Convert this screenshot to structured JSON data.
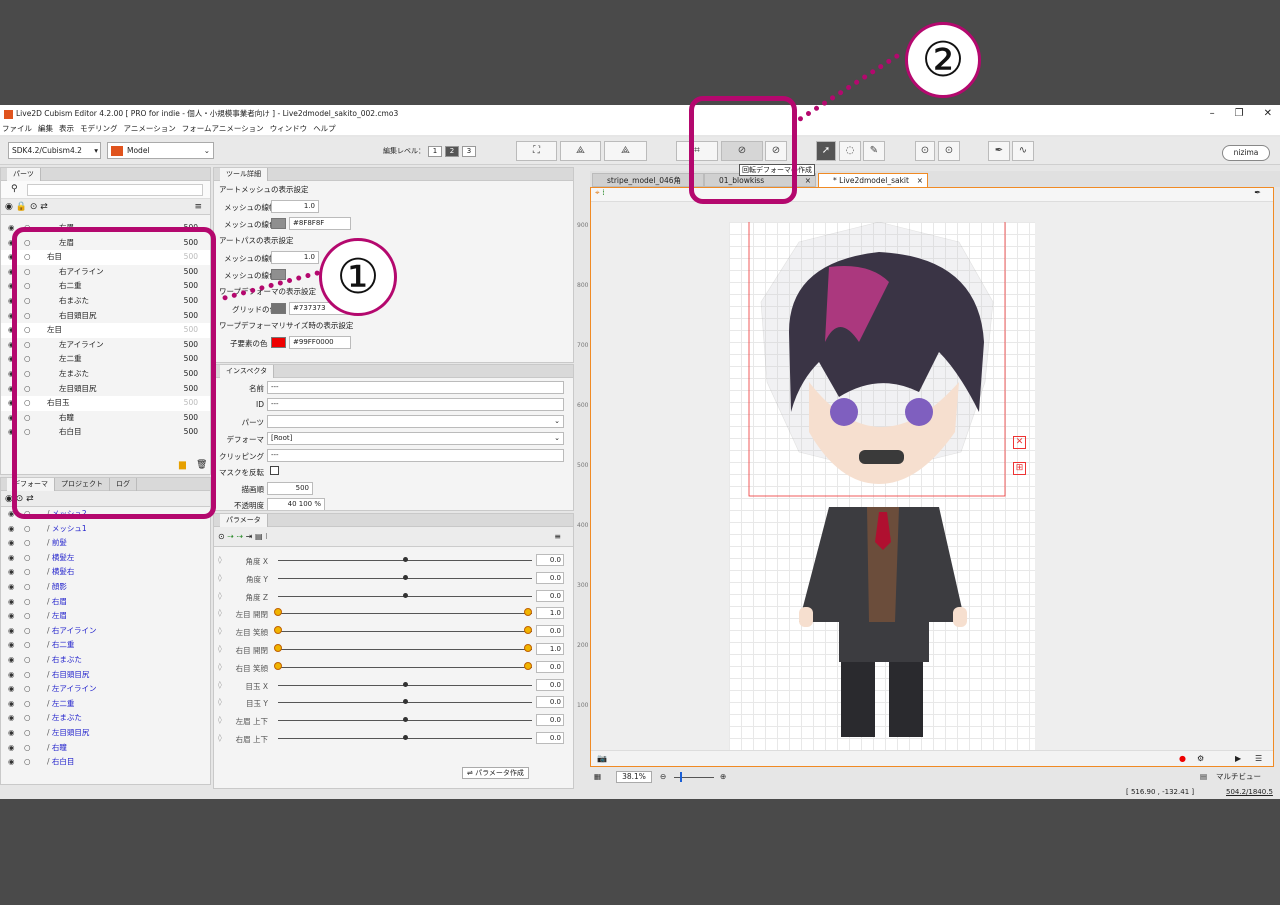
{
  "app": {
    "title": "Live2D Cubism Editor 4.2.00  [ PRO for indie - 個人・小規模事業者向け ] - Live2dmodel_sakito_002.cmo3"
  },
  "menu": [
    "ファイル",
    "編集",
    "表示",
    "モデリング",
    "アニメーション",
    "フォームアニメーション",
    "ウィンドウ",
    "ヘルプ"
  ],
  "toolbar": {
    "sdk": "SDK4.2/Cubism4.2",
    "mode": "Model",
    "edit_level_label": "編集レベル：",
    "levels": [
      "1",
      "2",
      "3"
    ],
    "brand": "nizima",
    "tooltip": "回転デフォーマの作成"
  },
  "parts_panel": {
    "tab": "パーツ",
    "rows": [
      {
        "name": "右眉",
        "num": "500",
        "indent": 58,
        "fold": false
      },
      {
        "name": "左眉",
        "num": "500",
        "indent": 58,
        "fold": false
      },
      {
        "name": "右目",
        "num": "500",
        "indent": 46,
        "fold": true
      },
      {
        "name": "右アイライン",
        "num": "500",
        "indent": 58,
        "fold": false
      },
      {
        "name": "右二重",
        "num": "500",
        "indent": 58,
        "fold": false
      },
      {
        "name": "右まぶた",
        "num": "500",
        "indent": 58,
        "fold": false
      },
      {
        "name": "右目頭目尻",
        "num": "500",
        "indent": 58,
        "fold": false
      },
      {
        "name": "左目",
        "num": "500",
        "indent": 46,
        "fold": true
      },
      {
        "name": "左アイライン",
        "num": "500",
        "indent": 58,
        "fold": false
      },
      {
        "name": "左二重",
        "num": "500",
        "indent": 58,
        "fold": false
      },
      {
        "name": "左まぶた",
        "num": "500",
        "indent": 58,
        "fold": false
      },
      {
        "name": "左目頭目尻",
        "num": "500",
        "indent": 58,
        "fold": false
      },
      {
        "name": "右目玉",
        "num": "500",
        "indent": 46,
        "fold": true
      },
      {
        "name": "右瞳",
        "num": "500",
        "indent": 58,
        "fold": false
      },
      {
        "name": "右白目",
        "num": "500",
        "indent": 58,
        "fold": false
      }
    ]
  },
  "deformer_panel": {
    "tabs": [
      "デフォーマ",
      "プロジェクト",
      "ログ"
    ],
    "rows": [
      "メッシュ2",
      "メッシュ1",
      "前髪",
      "横髪左",
      "横髪右",
      "顔影",
      "右眉",
      "左眉",
      "右アイライン",
      "右二重",
      "右まぶた",
      "右目頭目尻",
      "左アイライン",
      "左二重",
      "左まぶた",
      "左目頭目尻",
      "右瞳",
      "右白目"
    ]
  },
  "tool_details": {
    "tab": "ツール詳細",
    "sec1": "アートメッシュの表示設定",
    "mesh_width_label": "メッシュの線幅",
    "mesh_width": "1.0",
    "mesh_color_label": "メッシュの線色",
    "mesh_color": "#8F8F8F",
    "sec2": "アートパスの表示設定",
    "path_width_label": "メッシュの線幅",
    "path_width": "1.0",
    "path_color_label": "メッシュの線色",
    "sec3": "ワープデフォーマの表示設定",
    "grid_color_label": "グリッドの色",
    "grid_color": "#737373",
    "sec4": "ワープデフォーマリサイズ時の表示設定",
    "child_color_label": "子要素の色",
    "child_color": "#99FF0000"
  },
  "inspector": {
    "tab": "インスペクタ",
    "name_label": "名前",
    "name": "---",
    "id_label": "ID",
    "id": "---",
    "parts_label": "パーツ",
    "deformer_label": "デフォーマ",
    "deformer": "[Root]",
    "clipping_label": "クリッピング",
    "clipping": "---",
    "mask_label": "マスクを反転",
    "order_label": "描画順",
    "order": "500",
    "opacity_label": "不透明度",
    "opacity": "40 100 %"
  },
  "parameters": {
    "tab": "パラメータ",
    "create_label": "パラメータ作成",
    "rows": [
      {
        "name": "角度 X",
        "value": "0.0",
        "pos": 0.5,
        "keys": false
      },
      {
        "name": "角度 Y",
        "value": "0.0",
        "pos": 0.5,
        "keys": false
      },
      {
        "name": "角度 Z",
        "value": "0.0",
        "pos": 0.5,
        "keys": false
      },
      {
        "name": "左目 開閉",
        "value": "1.0",
        "pos": 1.0,
        "keys": true
      },
      {
        "name": "左目 笑顔",
        "value": "0.0",
        "pos": 0.0,
        "keys": true
      },
      {
        "name": "右目 開閉",
        "value": "1.0",
        "pos": 1.0,
        "keys": true
      },
      {
        "name": "右目 笑顔",
        "value": "0.0",
        "pos": 0.0,
        "keys": true
      },
      {
        "name": "目玉 X",
        "value": "0.0",
        "pos": 0.5,
        "keys": false
      },
      {
        "name": "目玉 Y",
        "value": "0.0",
        "pos": 0.5,
        "keys": false
      },
      {
        "name": "左眉 上下",
        "value": "0.0",
        "pos": 0.5,
        "keys": false
      },
      {
        "name": "右眉 上下",
        "value": "0.0",
        "pos": 0.5,
        "keys": false
      }
    ]
  },
  "view": {
    "tabs": [
      "stripe_model_046角",
      "01_blowkiss",
      "* Live2dmodel_sakit"
    ],
    "zoom": "38.1%",
    "ruler": [
      "900",
      "800",
      "700",
      "600",
      "500",
      "400",
      "300",
      "200",
      "100"
    ],
    "preview": "マルチビュー",
    "coords": "[  516.90 , -132.41 ]",
    "coords2": "504.2/1840.5"
  },
  "annotations": {
    "one": "①",
    "two": "②",
    "color": "#b4086e"
  }
}
